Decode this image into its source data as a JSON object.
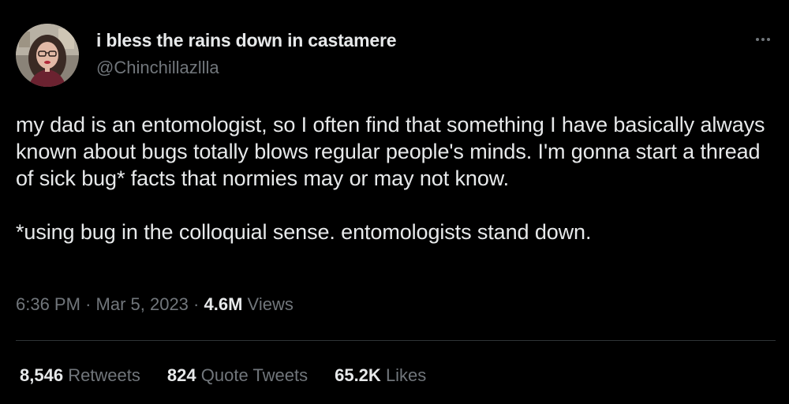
{
  "tweet": {
    "author": {
      "display_name": "i bless the rains down in castamere",
      "handle": "@Chinchillazllla",
      "avatar_icon": "profile-photo"
    },
    "more_icon": "more-horizontal-icon",
    "text_paragraph_1": "my dad is an entomologist, so I often find that something I have basically always known about bugs totally blows regular people's minds. I'm gonna start a thread of sick bug* facts that normies may or may not know.",
    "text_paragraph_2": "*using bug in the colloquial sense. entomologists stand down.",
    "meta": {
      "time": "6:36 PM",
      "separator": "·",
      "date": "Mar 5, 2023",
      "views_count": "4.6M",
      "views_label": "Views"
    },
    "stats": {
      "retweets_count": "8,546",
      "retweets_label": "Retweets",
      "quotes_count": "824",
      "quotes_label": "Quote Tweets",
      "likes_count": "65.2K",
      "likes_label": "Likes"
    }
  },
  "colors": {
    "background": "#000000",
    "primary_text": "#e7e9ea",
    "secondary_text": "#71767b",
    "divider": "#2f3336"
  }
}
